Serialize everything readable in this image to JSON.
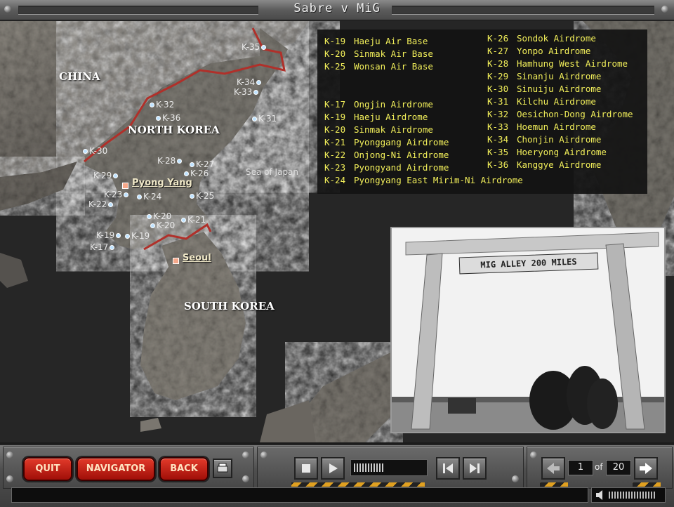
{
  "window": {
    "title": "Sabre v MiG"
  },
  "map": {
    "countries": {
      "china": "CHINA",
      "north_korea": "NORTH KOREA",
      "south_korea": "SOUTH KOREA"
    },
    "cities": {
      "pyongyang": "Pyong Yang",
      "seoul": "Seoul"
    },
    "sea": "Sea of Japan",
    "bases": [
      "K-35",
      "K-34",
      "K-33",
      "K-32",
      "K-36",
      "K-31",
      "K-30",
      "K-28",
      "K-27",
      "K-26",
      "K-29",
      "K-25",
      "K-23",
      "K-24",
      "K-22",
      "K-20",
      "K-20",
      "K-21",
      "K-19",
      "K-19",
      "K-17"
    ]
  },
  "legend": {
    "col1_top": [
      {
        "code": "K-19",
        "name": "Haeju Air Base"
      },
      {
        "code": "K-20",
        "name": "Sinmak Air Base"
      },
      {
        "code": "K-25",
        "name": "Wonsan Air Base"
      }
    ],
    "col1_bottom": [
      {
        "code": "K-17",
        "name": "Ongjin Airdrome"
      },
      {
        "code": "K-19",
        "name": "Haeju Airdrome"
      },
      {
        "code": "K-20",
        "name": "Sinmak Airdrome"
      },
      {
        "code": "K-21",
        "name": "Pyonggang Airdrome"
      },
      {
        "code": "K-22",
        "name": "Onjong-Ni Airdrome"
      },
      {
        "code": "K-23",
        "name": "Pyongyand Airdrome"
      },
      {
        "code": "K-24",
        "name": "Pyongyang East Mirim-Ni Airdrome"
      }
    ],
    "col2": [
      {
        "code": "K-26",
        "name": "Sondok Airdrome"
      },
      {
        "code": "K-27",
        "name": "Yonpo Airdrome"
      },
      {
        "code": "K-28",
        "name": "Hamhung West Airdrome"
      },
      {
        "code": "K-29",
        "name": "Sinanju Airdrome"
      },
      {
        "code": "K-30",
        "name": "Sinuiju Airdrome"
      },
      {
        "code": "K-31",
        "name": "Kilchu Airdrome"
      },
      {
        "code": "K-32",
        "name": "Oesichon-Dong Airdrome"
      },
      {
        "code": "K-33",
        "name": "Hoemun Airdrome"
      },
      {
        "code": "K-34",
        "name": "Chonjin Airdrome"
      },
      {
        "code": "K-35",
        "name": "Hoeryong Airdrome"
      },
      {
        "code": "K-36",
        "name": "Kanggye Airdrome"
      }
    ]
  },
  "photo": {
    "sign_text": "MIG ALLEY 200 MILES"
  },
  "toolbar": {
    "quit_label": "QUIT",
    "navigator_label": "NAVIGATOR",
    "back_label": "BACK",
    "page_current": "1",
    "page_of": "of",
    "page_total": "20"
  },
  "icons": {
    "print": "printer-icon",
    "stop": "stop-icon",
    "play": "play-icon",
    "prev": "skip-back-icon",
    "next": "skip-forward-icon",
    "page_prev": "arrow-left-icon",
    "page_next": "arrow-right-icon",
    "volume": "speaker-icon"
  },
  "colors": {
    "legend_text": "#f2ef5a",
    "border_line": "#b0302a",
    "button_red": "#c8201a"
  }
}
